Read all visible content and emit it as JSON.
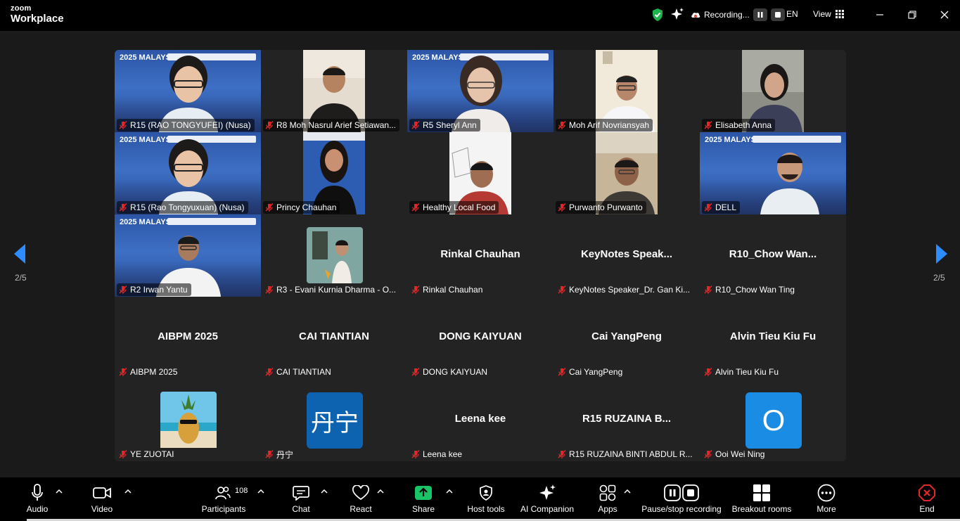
{
  "app": {
    "logo_top": "zoom",
    "logo_bottom": "Workplace"
  },
  "titlebar": {
    "recording_label": "Recording...",
    "language": "EN",
    "view_label": "View",
    "colors": {
      "shield": "#1fb34f",
      "recording": "#e04a3c"
    }
  },
  "tiles": [
    {
      "name": "R15 (RAO TONGYUFEI) (Nusa)",
      "kind": "banner",
      "banner_text": "2025 MALAYSIA ICPM"
    },
    {
      "name": "R8 Moh Nasrul Arief Setiawan...",
      "kind": "photo"
    },
    {
      "name": "R5 Sheryl Ann",
      "kind": "banner",
      "banner_text": "2025 MALAYSIA ICPM"
    },
    {
      "name": "Moh Arif Novriansyah",
      "kind": "photo"
    },
    {
      "name": "Elisabeth Anna",
      "kind": "photo"
    },
    {
      "name": "R15 (Rao Tongyuxuan) (Nusa)",
      "kind": "banner",
      "banner_text": "2025 MALAYSIA ICPM"
    },
    {
      "name": "Princy Chauhan",
      "kind": "photo"
    },
    {
      "name": "Healthy Local Food",
      "kind": "photo"
    },
    {
      "name": "Purwanto Purwanto",
      "kind": "photo"
    },
    {
      "name": "DELL",
      "kind": "banner",
      "banner_text": "2025 MALAYSIA ICPM"
    },
    {
      "name": "R2 Irwan Yantu",
      "kind": "banner",
      "banner_text": "2025 MALAYSIA ICPM"
    },
    {
      "name": "R3 - Evani Kurnia Dharma - O...",
      "kind": "photo"
    },
    {
      "name": "Rinkal Chauhan",
      "kind": "text",
      "display": "Rinkal Chauhan"
    },
    {
      "name": "KeyNotes Speaker_Dr. Gan Ki...",
      "kind": "text",
      "display": "KeyNotes  Speak..."
    },
    {
      "name": "R10_Chow Wan Ting",
      "kind": "text",
      "display": "R10_Chow  Wan..."
    },
    {
      "name": "AIBPM 2025",
      "kind": "text",
      "display": "AIBPM 2025"
    },
    {
      "name": "CAI TIANTIAN",
      "kind": "text",
      "display": "CAI TIANTIAN"
    },
    {
      "name": "DONG KAIYUAN",
      "kind": "text",
      "display": "DONG KAIYUAN"
    },
    {
      "name": "Cai YangPeng",
      "kind": "text",
      "display": "Cai YangPeng"
    },
    {
      "name": "Alvin Tieu Kiu Fu",
      "kind": "text",
      "display": "Alvin Tieu Kiu Fu"
    },
    {
      "name": "YE ZUOTAI",
      "kind": "pineapple"
    },
    {
      "name": "丹宁",
      "kind": "avatar",
      "avatar_text": "丹宁",
      "avatar_color": "#0e63b0"
    },
    {
      "name": "Leena kee",
      "kind": "text",
      "display": "Leena kee"
    },
    {
      "name": "R15 RUZAINA BINTI ABDUL R...",
      "kind": "text",
      "display": "R15 RUZAINA B..."
    },
    {
      "name": "Ooi Wei Ning",
      "kind": "avatar",
      "avatar_text": "O",
      "avatar_color": "#1b8ce3"
    }
  ],
  "pagination": {
    "left": "2/5",
    "right": "2/5"
  },
  "toolbar": {
    "audio": "Audio",
    "video": "Video",
    "participants": "Participants",
    "participants_count": "108",
    "chat": "Chat",
    "react": "React",
    "share": "Share",
    "host_tools": "Host tools",
    "ai_companion": "AI Companion",
    "apps": "Apps",
    "pause_recording": "Pause/stop recording",
    "breakout": "Breakout rooms",
    "more": "More",
    "end": "End",
    "colors": {
      "share": "#18c466",
      "end": "#e02828"
    }
  }
}
